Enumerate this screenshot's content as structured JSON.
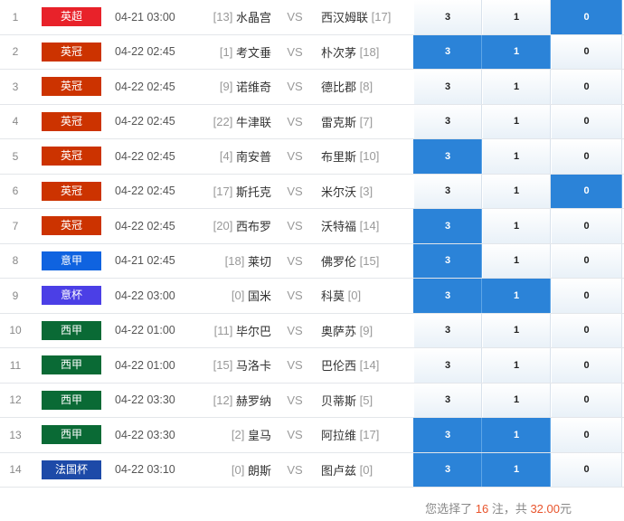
{
  "colors": {
    "selected": "#2b83d8",
    "highlight": "#e8542c"
  },
  "vs_label": "VS",
  "matches": [
    {
      "num": "1",
      "league": "英超",
      "league_color": "#e8222a",
      "time": "04-21 03:00",
      "home_rank": "[13]",
      "home": "水晶宫",
      "away": "西汉姆联",
      "away_rank": "[17]",
      "odds": [
        "3",
        "1",
        "0"
      ],
      "selected": [
        false,
        false,
        true
      ]
    },
    {
      "num": "2",
      "league": "英冠",
      "league_color": "#cc3300",
      "time": "04-22 02:45",
      "home_rank": "[1]",
      "home": "考文垂",
      "away": "朴次茅",
      "away_rank": "[18]",
      "odds": [
        "3",
        "1",
        "0"
      ],
      "selected": [
        true,
        true,
        false
      ]
    },
    {
      "num": "3",
      "league": "英冠",
      "league_color": "#cc3300",
      "time": "04-22 02:45",
      "home_rank": "[9]",
      "home": "诺维奇",
      "away": "德比郡",
      "away_rank": "[8]",
      "odds": [
        "3",
        "1",
        "0"
      ],
      "selected": [
        false,
        false,
        false
      ]
    },
    {
      "num": "4",
      "league": "英冠",
      "league_color": "#cc3300",
      "time": "04-22 02:45",
      "home_rank": "[22]",
      "home": "牛津联",
      "away": "雷克斯",
      "away_rank": "[7]",
      "odds": [
        "3",
        "1",
        "0"
      ],
      "selected": [
        false,
        false,
        false
      ]
    },
    {
      "num": "5",
      "league": "英冠",
      "league_color": "#cc3300",
      "time": "04-22 02:45",
      "home_rank": "[4]",
      "home": "南安普",
      "away": "布里斯",
      "away_rank": "[10]",
      "odds": [
        "3",
        "1",
        "0"
      ],
      "selected": [
        true,
        false,
        false
      ]
    },
    {
      "num": "6",
      "league": "英冠",
      "league_color": "#cc3300",
      "time": "04-22 02:45",
      "home_rank": "[17]",
      "home": "斯托克",
      "away": "米尔沃",
      "away_rank": "[3]",
      "odds": [
        "3",
        "1",
        "0"
      ],
      "selected": [
        false,
        false,
        true
      ]
    },
    {
      "num": "7",
      "league": "英冠",
      "league_color": "#cc3300",
      "time": "04-22 02:45",
      "home_rank": "[20]",
      "home": "西布罗",
      "away": "沃特福",
      "away_rank": "[14]",
      "odds": [
        "3",
        "1",
        "0"
      ],
      "selected": [
        true,
        false,
        false
      ]
    },
    {
      "num": "8",
      "league": "意甲",
      "league_color": "#0f63e0",
      "time": "04-21 02:45",
      "home_rank": "[18]",
      "home": "莱切",
      "away": "佛罗伦",
      "away_rank": "[15]",
      "odds": [
        "3",
        "1",
        "0"
      ],
      "selected": [
        true,
        false,
        false
      ]
    },
    {
      "num": "9",
      "league": "意杯",
      "league_color": "#4b3fe6",
      "time": "04-22 03:00",
      "home_rank": "[0]",
      "home": "国米",
      "away": "科莫",
      "away_rank": "[0]",
      "odds": [
        "3",
        "1",
        "0"
      ],
      "selected": [
        true,
        true,
        false
      ]
    },
    {
      "num": "10",
      "league": "西甲",
      "league_color": "#0a6a35",
      "time": "04-22 01:00",
      "home_rank": "[11]",
      "home": "毕尔巴",
      "away": "奥萨苏",
      "away_rank": "[9]",
      "odds": [
        "3",
        "1",
        "0"
      ],
      "selected": [
        false,
        false,
        false
      ]
    },
    {
      "num": "11",
      "league": "西甲",
      "league_color": "#0a6a35",
      "time": "04-22 01:00",
      "home_rank": "[15]",
      "home": "马洛卡",
      "away": "巴伦西",
      "away_rank": "[14]",
      "odds": [
        "3",
        "1",
        "0"
      ],
      "selected": [
        false,
        false,
        false
      ]
    },
    {
      "num": "12",
      "league": "西甲",
      "league_color": "#0a6a35",
      "time": "04-22 03:30",
      "home_rank": "[12]",
      "home": "赫罗纳",
      "away": "贝蒂斯",
      "away_rank": "[5]",
      "odds": [
        "3",
        "1",
        "0"
      ],
      "selected": [
        false,
        false,
        false
      ]
    },
    {
      "num": "13",
      "league": "西甲",
      "league_color": "#0a6a35",
      "time": "04-22 03:30",
      "home_rank": "[2]",
      "home": "皇马",
      "away": "阿拉维",
      "away_rank": "[17]",
      "odds": [
        "3",
        "1",
        "0"
      ],
      "selected": [
        true,
        true,
        false
      ]
    },
    {
      "num": "14",
      "league": "法国杯",
      "league_color": "#1d4aa8",
      "time": "04-22 03:10",
      "home_rank": "[0]",
      "home": "朗斯",
      "away": "图卢兹",
      "away_rank": "[0]",
      "odds": [
        "3",
        "1",
        "0"
      ],
      "selected": [
        true,
        true,
        false
      ]
    }
  ],
  "summary": {
    "prefix": "您选择了 ",
    "count": "16",
    "mid": " 注，共 ",
    "amount": "32.00",
    "unit": "元"
  }
}
